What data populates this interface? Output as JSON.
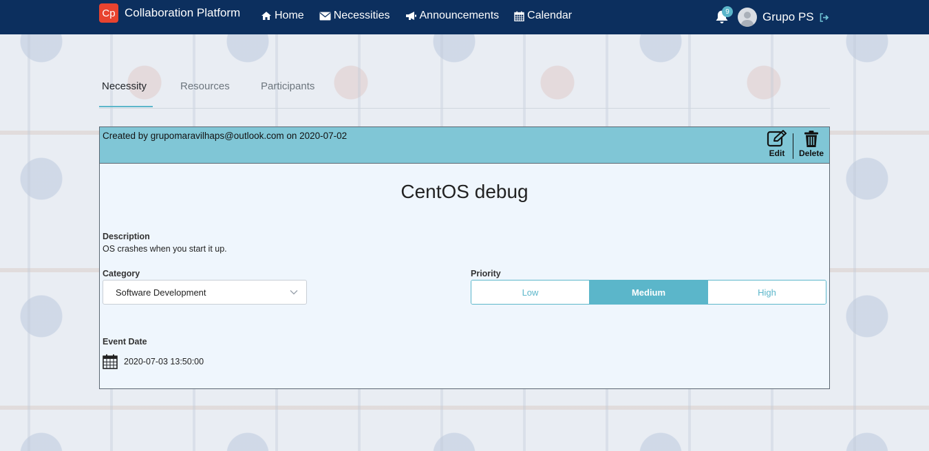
{
  "navbar": {
    "logo_text": "Cp",
    "brand": "Collaboration Platform",
    "links": [
      {
        "label": "Home",
        "icon": "home-icon"
      },
      {
        "label": "Necessities",
        "icon": "envelope-icon"
      },
      {
        "label": "Announcements",
        "icon": "bullhorn-icon"
      },
      {
        "label": "Calendar",
        "icon": "calendar-icon"
      }
    ],
    "notification_count": "9",
    "user_name": "Grupo PS"
  },
  "tabs": [
    {
      "label": "Necessity",
      "active": true
    },
    {
      "label": "Resources",
      "active": false
    },
    {
      "label": "Participants",
      "active": false
    }
  ],
  "card": {
    "created": "Created by grupomaravilhaps@outlook.com on 2020-07-02",
    "edit_label": "Edit",
    "delete_label": "Delete",
    "title": "CentOS debug",
    "description_label": "Description",
    "description": "OS crashes when you start it up.",
    "category_label": "Category",
    "category_value": "Software Development",
    "priority_label": "Priority",
    "priority_options": [
      "Low",
      "Medium",
      "High"
    ],
    "priority_selected": "Medium",
    "event_date_label": "Event Date",
    "event_date": "2020-07-03 13:50:00"
  },
  "colors": {
    "navbar": "#0c2f5e",
    "accent": "#5bb6ca",
    "card_header": "#80c6d6",
    "logo": "#e8432f"
  }
}
